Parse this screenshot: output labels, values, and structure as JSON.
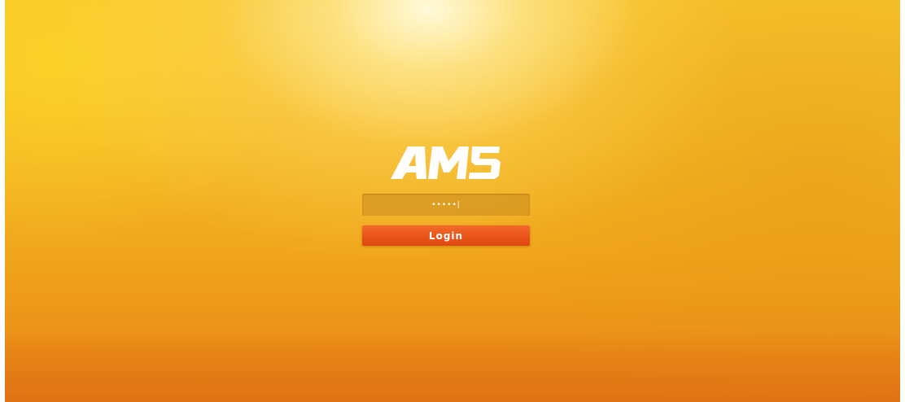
{
  "app": {
    "logo_text": "AMS"
  },
  "login_form": {
    "password_value": "•••••|",
    "login_label": "Login"
  },
  "colors": {
    "background_top": "#f7c22a",
    "background_bottom": "#e27a14",
    "button": "#ea5418",
    "field": "#c88c1e"
  }
}
